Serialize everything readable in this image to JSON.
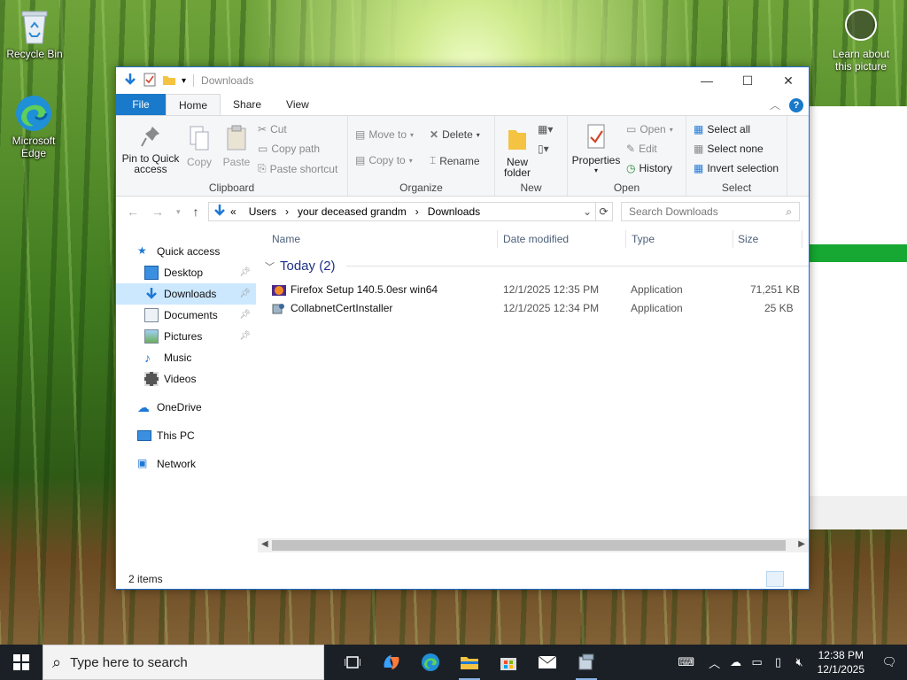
{
  "desktop": {
    "recycle_bin": "Recycle Bin",
    "edge": "Microsoft Edge",
    "learn": "Learn about this picture"
  },
  "window": {
    "title": "Downloads",
    "tabs": {
      "file": "File",
      "home": "Home",
      "share": "Share",
      "view": "View"
    }
  },
  "ribbon": {
    "clipboard": {
      "pin": "Pin to Quick access",
      "copy": "Copy",
      "paste": "Paste",
      "cut": "Cut",
      "copy_path": "Copy path",
      "paste_shortcut": "Paste shortcut",
      "label": "Clipboard"
    },
    "organize": {
      "move_to": "Move to",
      "copy_to": "Copy to",
      "delete": "Delete",
      "rename": "Rename",
      "label": "Organize"
    },
    "new": {
      "new_folder": "New folder",
      "label": "New"
    },
    "open": {
      "properties": "Properties",
      "open": "Open",
      "edit": "Edit",
      "history": "History",
      "label": "Open"
    },
    "select": {
      "select_all": "Select all",
      "select_none": "Select none",
      "invert": "Invert selection",
      "label": "Select"
    }
  },
  "address": {
    "prefix": "«",
    "crumbs": [
      "Users",
      "your deceased grandm",
      "Downloads"
    ],
    "search_placeholder": "Search Downloads"
  },
  "navpane": {
    "quick_access": "Quick access",
    "items": [
      "Desktop",
      "Downloads",
      "Documents",
      "Pictures",
      "Music",
      "Videos"
    ],
    "onedrive": "OneDrive",
    "this_pc": "This PC",
    "network": "Network"
  },
  "columns": {
    "name": "Name",
    "date": "Date modified",
    "type": "Type",
    "size": "Size"
  },
  "group": {
    "label": "Today (2)"
  },
  "files": [
    {
      "name": "Firefox Setup 140.5.0esr win64",
      "date": "12/1/2025 12:35 PM",
      "type": "Application",
      "size": "71,251 KB"
    },
    {
      "name": "CollabnetCertInstaller",
      "date": "12/1/2025 12:34 PM",
      "type": "Application",
      "size": "25 KB"
    }
  ],
  "status": {
    "items": "2 items"
  },
  "taskbar": {
    "search_placeholder": "Type here to search",
    "time": "12:38 PM",
    "date": "12/1/2025"
  }
}
